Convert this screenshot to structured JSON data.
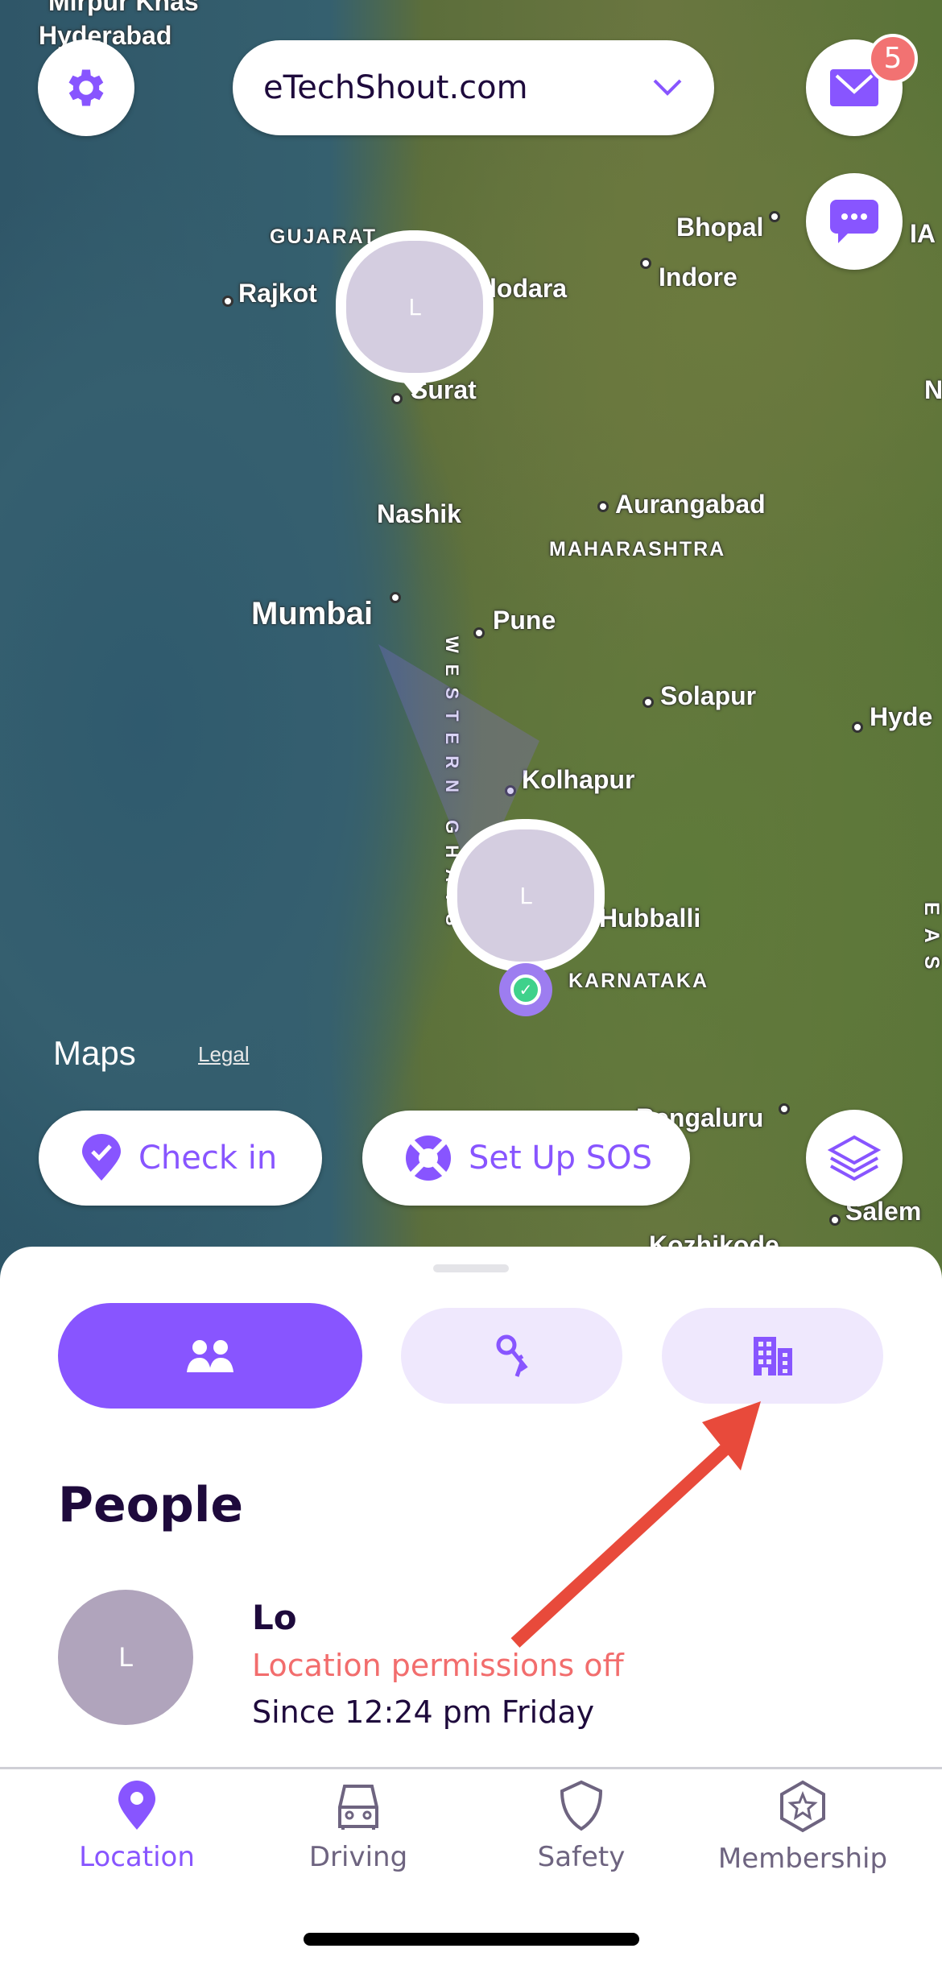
{
  "header": {
    "circle_name": "eTechShout.com",
    "mail_badge": "5"
  },
  "map": {
    "labels": [
      "Mirpur Khas",
      "Hyderabad",
      "GUJARAT",
      "Rajkot",
      "Vadodara",
      "Surat",
      "Bhopal",
      "Indore",
      "Nashik",
      "Aurangabad",
      "MAHARASHTRA",
      "Mumbai",
      "Pune",
      "Solapur",
      "Hyde",
      "Kolhapur",
      "Hubballi",
      "KARNATAKA",
      "Bengaluru",
      "Salem",
      "Kozhikode",
      "WESTERN GHATS",
      "N",
      "IA",
      "EAS"
    ],
    "attribution": "Maps",
    "legal": "Legal",
    "pins": [
      {
        "initial": "L"
      },
      {
        "initial": "L"
      }
    ]
  },
  "actions": {
    "check_in": "Check in",
    "sos": "Set Up SOS"
  },
  "sheet": {
    "tabs": [
      {
        "icon": "people-icon",
        "active": true
      },
      {
        "icon": "keys-icon",
        "active": false
      },
      {
        "icon": "building-icon",
        "active": false
      }
    ],
    "title": "People",
    "people": [
      {
        "initial": "L",
        "name": "Lo",
        "status": "Location permissions off",
        "since": "Since 12:24 pm Friday"
      }
    ]
  },
  "nav": [
    {
      "label": "Location",
      "active": true
    },
    {
      "label": "Driving"
    },
    {
      "label": "Safety"
    },
    {
      "label": "Membership"
    }
  ],
  "colors": {
    "accent": "#8855ff",
    "accent_light": "#efe8fd",
    "warning": "#f26d6d",
    "text": "#1e0a3c",
    "annotation_arrow": "#e84a3b"
  }
}
